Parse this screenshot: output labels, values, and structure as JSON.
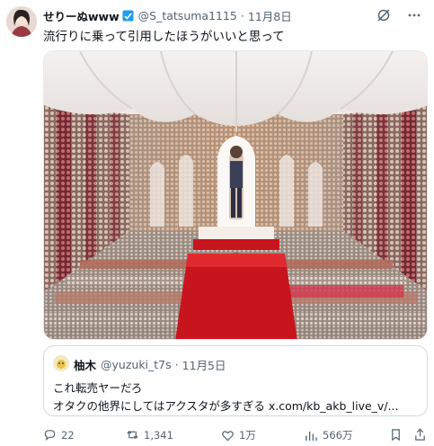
{
  "tweet": {
    "author_name": "せりーぬwww",
    "handle": "@S_tatsuma1115",
    "separator": "·",
    "date": "11月8日",
    "text": "流行りに乗って引用したほうがいいと思って"
  },
  "quote": {
    "author_name": "柚木",
    "handle": "@yuzuki_t7s",
    "separator": "·",
    "date": "11月5日",
    "line1": "これ転売ヤーだろ",
    "line2": "オタクの他界にしてはアクスタが多すぎる x.com/kb_akb_live_v/..."
  },
  "actions": {
    "replies": "22",
    "reposts": "1,341",
    "likes": "1万",
    "views": "566万"
  },
  "colors": {
    "text": "#0f1419",
    "secondary": "#536471",
    "border": "#cfd9de",
    "carpet": "#c8141c",
    "verified": "#1d9bf0"
  },
  "icons": [
    "grok-icon",
    "more-icon",
    "reply-icon",
    "repost-icon",
    "like-icon",
    "views-icon",
    "bookmark-icon",
    "share-icon",
    "verified-icon"
  ]
}
